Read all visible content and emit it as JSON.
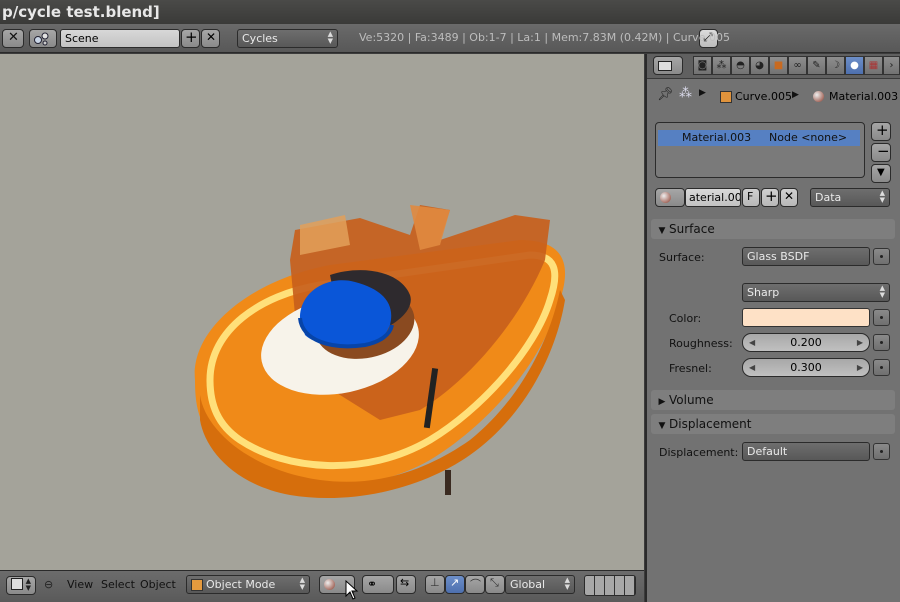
{
  "window": {
    "title": "p/cycle test.blend]"
  },
  "infobar": {
    "scene_label": "Scene",
    "engine": "Cycles",
    "stats": "Ve:5320 | Fa:3489 | Ob:1-7 | La:1 | Mem:7.83M (0.42M) | Curve.005"
  },
  "viewport_header": {
    "menu_view": "View",
    "menu_select": "Select",
    "menu_object": "Object",
    "mode": "Object Mode",
    "orientation": "Global"
  },
  "properties": {
    "breadcrumb_object": "Curve.005",
    "breadcrumb_material": "Material.003",
    "material_slot": {
      "name": "Material.003",
      "node": "Node <none>"
    },
    "material_name_field": "aterial.003",
    "fake_user_label": "F",
    "link_option": "Data",
    "sections": {
      "surface": "Surface",
      "volume": "Volume",
      "displacement": "Displacement"
    },
    "surface_label": "Surface:",
    "surface_shader": "Glass BSDF",
    "distribution": "Sharp",
    "color_label": "Color:",
    "color_value": "#fee1c6",
    "roughness_label": "Roughness:",
    "roughness_value": "0.200",
    "fresnel_label": "Fresnel:",
    "fresnel_value": "0.300",
    "displacement_label": "Displacement:",
    "displacement_value": "Default"
  },
  "colors": {
    "viewport_bg": "#a4a39a",
    "selection_blue": "#5680c2",
    "orange": "#f08a18"
  }
}
